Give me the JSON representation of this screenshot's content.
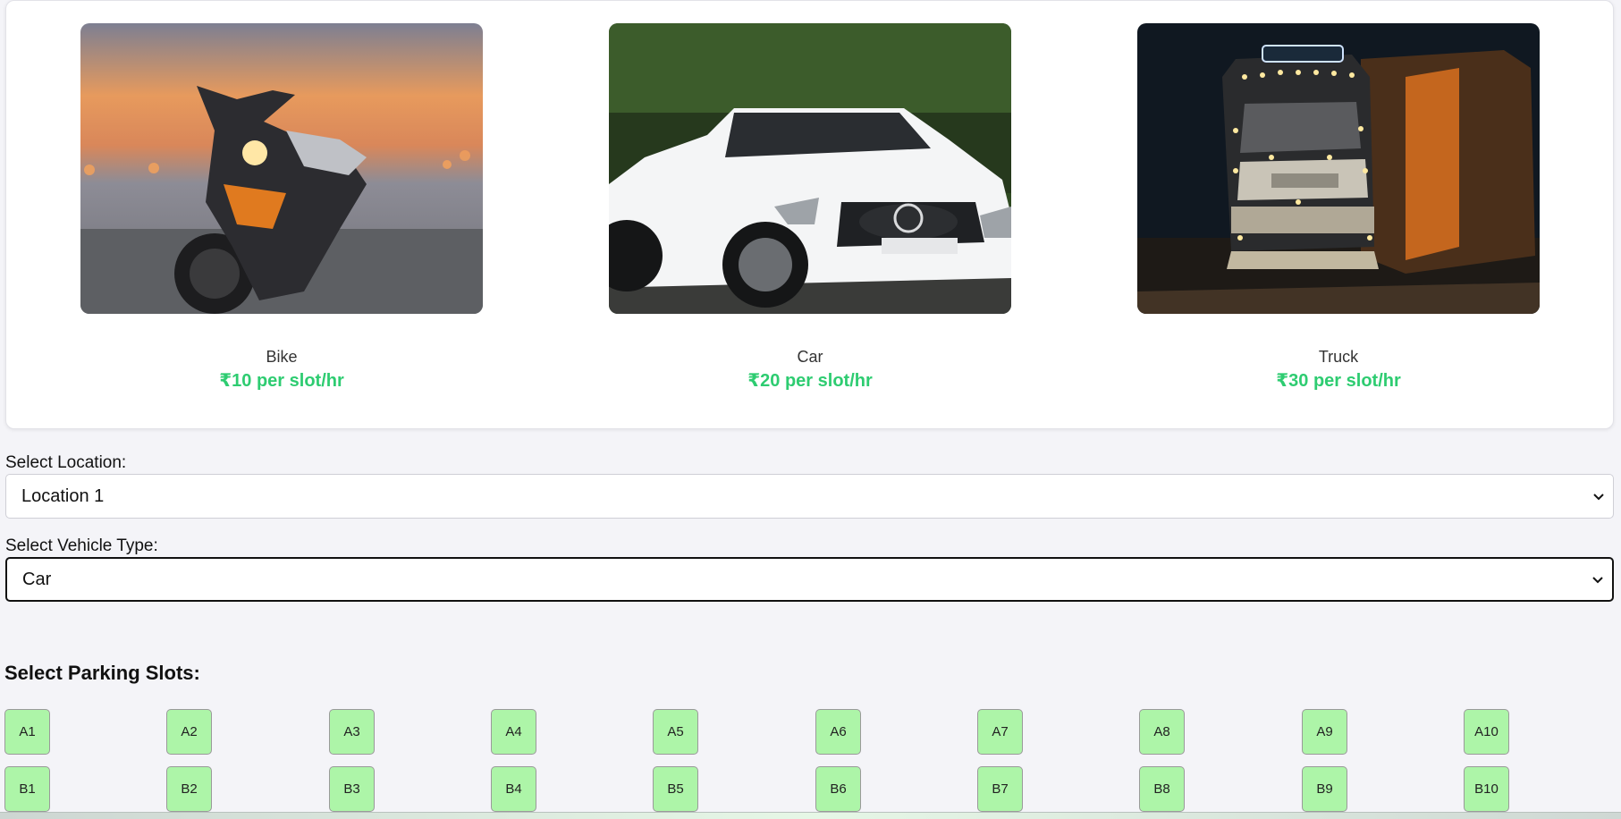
{
  "vehicles": [
    {
      "name": "Bike",
      "price": "₹10 per slot/hr",
      "image": "bike-photo"
    },
    {
      "name": "Car",
      "price": "₹20 per slot/hr",
      "image": "car-photo"
    },
    {
      "name": "Truck",
      "price": "₹30 per slot/hr",
      "image": "truck-photo"
    }
  ],
  "location": {
    "label": "Select Location:",
    "value": "Location 1"
  },
  "vehicle_type": {
    "label": "Select Vehicle Type:",
    "value": "Car"
  },
  "slots": {
    "title": "Select Parking Slots:",
    "rows": [
      [
        "A1",
        "A2",
        "A3",
        "A4",
        "A5",
        "A6",
        "A7",
        "A8",
        "A9",
        "A10"
      ],
      [
        "B1",
        "B2",
        "B3",
        "B4",
        "B5",
        "B6",
        "B7",
        "B8",
        "B9",
        "B10"
      ]
    ]
  },
  "colors": {
    "price": "#2ecc71",
    "slot_available": "#adf5a8",
    "page_bg": "#f4f4f8"
  }
}
